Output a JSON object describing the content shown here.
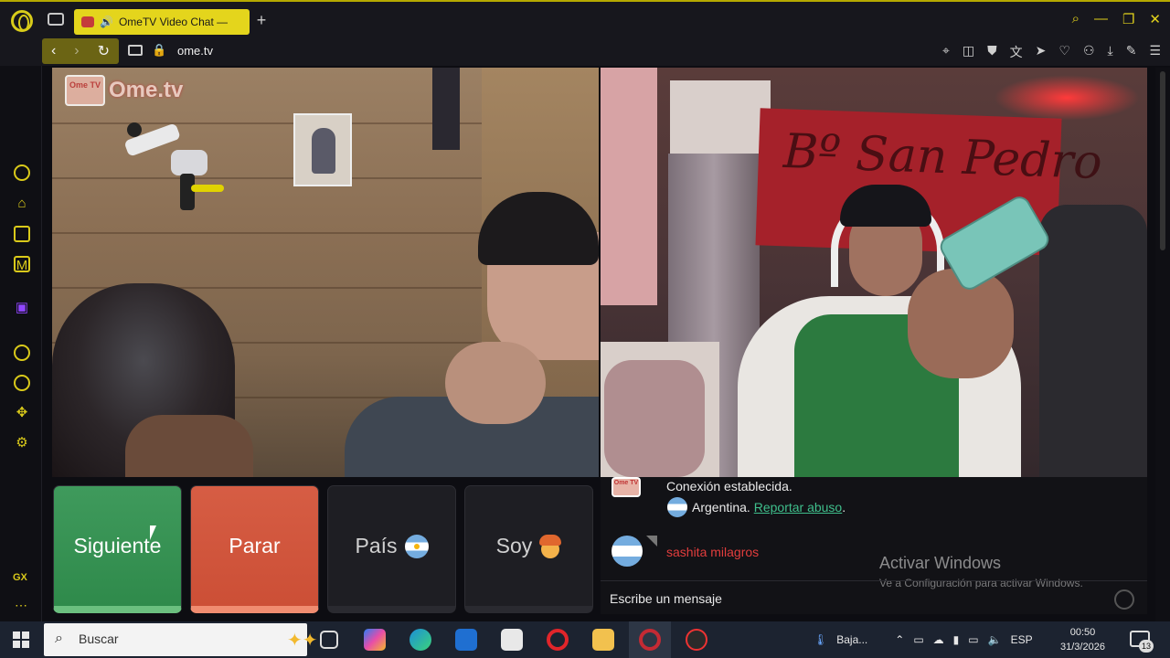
{
  "browser": {
    "tab_title": "OmeTV Video Chat —",
    "url": "ome.tv"
  },
  "video_left": {
    "logo_box": "Ome TV",
    "logo_text": "Ome.tv"
  },
  "video_right": {
    "banner_text": "Bº San Pedro"
  },
  "controls": {
    "next_label": "Siguiente",
    "stop_label": "Parar",
    "country_label": "País",
    "iam_label": "Soy"
  },
  "chat": {
    "logo_box": "Ome TV",
    "status_message": "Conexión establecida.",
    "country_text": "Argentina.",
    "report_label": "Reportar abuso",
    "report_suffix": ".",
    "partner_name": "sashita milagros",
    "input_placeholder": "Escribe un mensaje"
  },
  "windows_watermark": {
    "title": "Activar Windows",
    "subtitle": "Ve a Configuración para activar Windows."
  },
  "taskbar": {
    "search_placeholder": "Buscar",
    "weather_text": "Baja...",
    "lang": "ESP",
    "time": "00:50",
    "date": "31/3/2026",
    "notification_count": "13"
  },
  "colors": {
    "accent": "#e4d51c",
    "next_button": "#2f8a4b",
    "stop_button": "#cc4f36",
    "report_link": "#3fbf8c",
    "partner_name": "#e23d3d"
  }
}
